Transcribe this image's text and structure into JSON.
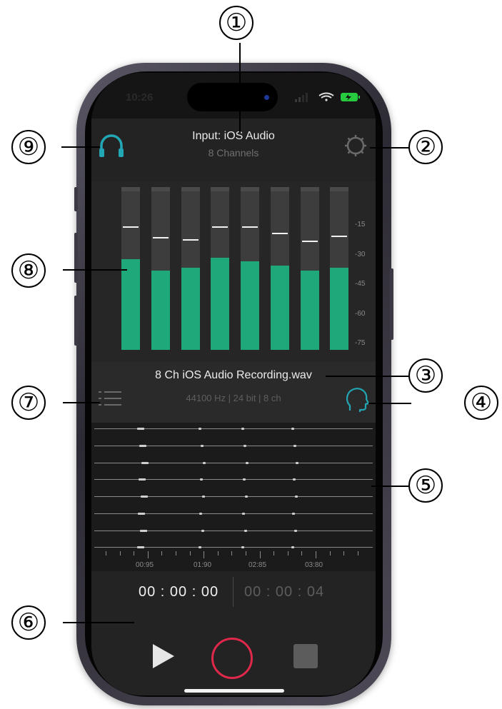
{
  "status_bar": {
    "time": "10:26"
  },
  "input": {
    "title": "Input: iOS Audio",
    "channels": "8 Channels"
  },
  "meters": {
    "channels": [
      {
        "level": 0.57,
        "peak": 0.78
      },
      {
        "level": 0.5,
        "peak": 0.71
      },
      {
        "level": 0.52,
        "peak": 0.7
      },
      {
        "level": 0.58,
        "peak": 0.78
      },
      {
        "level": 0.56,
        "peak": 0.78
      },
      {
        "level": 0.53,
        "peak": 0.74
      },
      {
        "level": 0.5,
        "peak": 0.69
      },
      {
        "level": 0.52,
        "peak": 0.72
      }
    ],
    "scale": [
      "-15",
      "-30",
      "-45",
      "-60",
      "-75"
    ],
    "fill_color": "#1fa87a"
  },
  "file": {
    "name": "8 Ch iOS Audio Recording.wav",
    "format": "44100 Hz | 24 bit | 8 ch"
  },
  "timeline": {
    "labels": [
      "00:95",
      "01:90",
      "02:85",
      "03:80"
    ]
  },
  "transport": {
    "current_time": "00 : 00 : 00",
    "total_time": "00 : 00 : 04",
    "record_color": "#e0284b"
  },
  "accent_color": "#22a6b3",
  "icons": {
    "headphones": "headphones-icon",
    "settings": "gear-icon",
    "list": "list-icon",
    "head": "head-profile-icon"
  },
  "annotations": [
    "①",
    "②",
    "③",
    "④",
    "⑤",
    "⑥",
    "⑦",
    "⑧",
    "⑨"
  ]
}
